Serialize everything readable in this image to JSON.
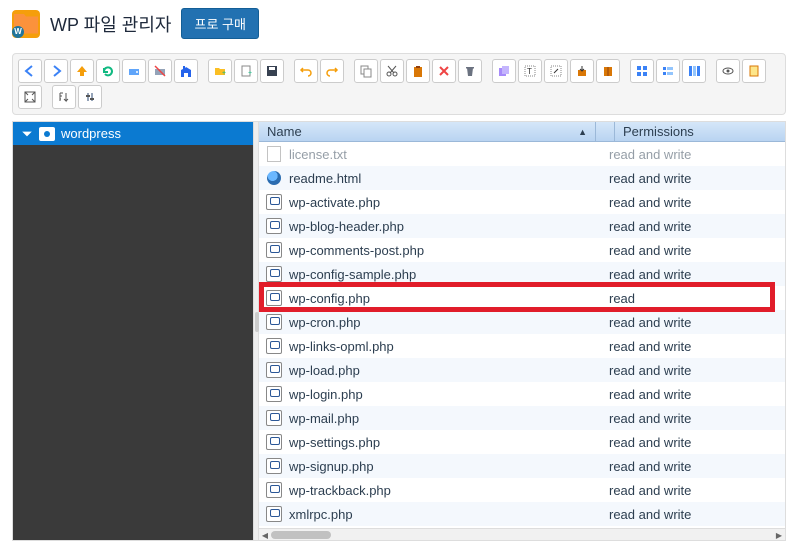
{
  "header": {
    "app_title": "WP 파일 관리자",
    "pro_button": "프로 구매"
  },
  "toolbar": {
    "icons": [
      "back-icon",
      "forward-icon",
      "up-icon",
      "reload-icon",
      "netdrive-icon",
      "netdrive-off-icon",
      "home-icon",
      "sep",
      "new-folder-icon",
      "new-file-icon",
      "save-icon",
      "sep",
      "undo-icon",
      "redo-icon",
      "sep",
      "copy-icon",
      "cut-icon",
      "paste-icon",
      "delete-icon",
      "trash-icon",
      "sep",
      "duplicate-icon",
      "edit-text-icon",
      "resize-icon",
      "extract-icon",
      "archive-icon",
      "sep",
      "icons-view-icon",
      "list-view-icon",
      "columns-view-icon",
      "sep",
      "preview-icon",
      "info-icon",
      "fullscreen-icon",
      "sep",
      "sort-icon",
      "settings-icon"
    ]
  },
  "tree": {
    "root_label": "wordpress"
  },
  "columns": {
    "name": "Name",
    "permissions": "Permissions"
  },
  "files": [
    {
      "icon": "txt",
      "name": "license.txt",
      "perm": "read and write",
      "prev": true
    },
    {
      "icon": "html",
      "name": "readme.html",
      "perm": "read and write"
    },
    {
      "icon": "php",
      "name": "wp-activate.php",
      "perm": "read and write"
    },
    {
      "icon": "php",
      "name": "wp-blog-header.php",
      "perm": "read and write"
    },
    {
      "icon": "php",
      "name": "wp-comments-post.php",
      "perm": "read and write"
    },
    {
      "icon": "php",
      "name": "wp-config-sample.php",
      "perm": "read and write"
    },
    {
      "icon": "php",
      "name": "wp-config.php",
      "perm": "read",
      "highlight": true
    },
    {
      "icon": "php",
      "name": "wp-cron.php",
      "perm": "read and write"
    },
    {
      "icon": "php",
      "name": "wp-links-opml.php",
      "perm": "read and write"
    },
    {
      "icon": "php",
      "name": "wp-load.php",
      "perm": "read and write"
    },
    {
      "icon": "php",
      "name": "wp-login.php",
      "perm": "read and write"
    },
    {
      "icon": "php",
      "name": "wp-mail.php",
      "perm": "read and write"
    },
    {
      "icon": "php",
      "name": "wp-settings.php",
      "perm": "read and write"
    },
    {
      "icon": "php",
      "name": "wp-signup.php",
      "perm": "read and write"
    },
    {
      "icon": "php",
      "name": "wp-trackback.php",
      "perm": "read and write"
    },
    {
      "icon": "php",
      "name": "xmlrpc.php",
      "perm": "read and write"
    }
  ],
  "colors": {
    "primary": "#0b7ad1",
    "highlight": "#e11d2a",
    "pro_button": "#2271b1"
  }
}
